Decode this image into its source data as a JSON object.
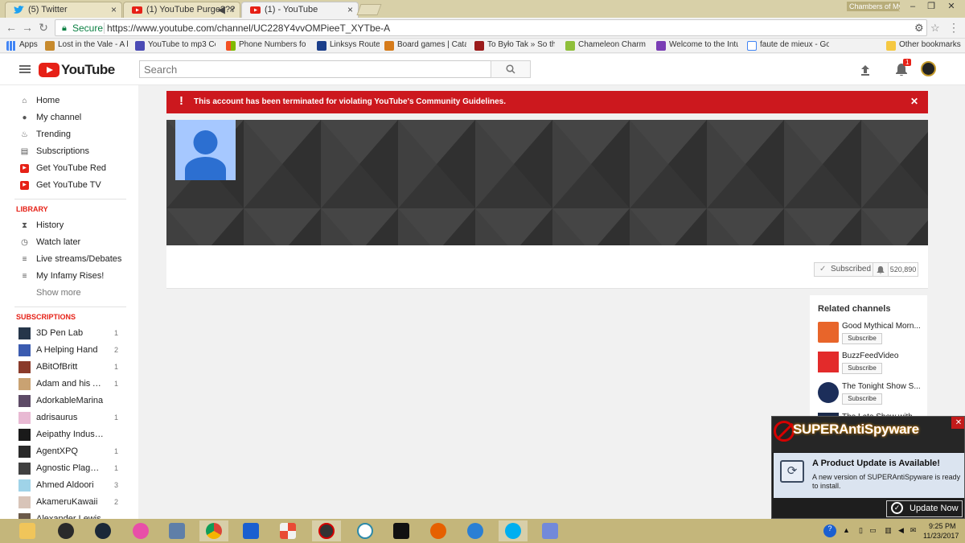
{
  "browser": {
    "tabs": [
      {
        "title": "(5) Twitter",
        "color": "#1da1f2"
      },
      {
        "title": "(1) YouTube Purge???",
        "color": "#e62117"
      },
      {
        "title": "(1) - YouTube",
        "color": "#e62117"
      }
    ],
    "profile_name": "Chambers of My",
    "secure_label": "Secure",
    "url": "https://www.youtube.com/channel/UC228Y4vvOMPieeT_XYTbe-A",
    "bookmarks": [
      "Apps",
      "Lost in the Vale - A lo",
      "YouTube to mp3 Con",
      "Phone Numbers for I",
      "Linksys Router",
      "Board games | Catan",
      "To Było Tak » So the",
      "Chameleon Charm - (",
      "Welcome to the Intuc",
      "faute de mieux - Goo",
      "Other bookmarks"
    ]
  },
  "youtube": {
    "logo_text": "YouTube",
    "search_placeholder": "Search",
    "notification_count": "1"
  },
  "sidebar": {
    "main_items": [
      "Home",
      "My channel",
      "Trending",
      "Subscriptions",
      "Get YouTube Red",
      "Get YouTube TV"
    ],
    "library_heading": "LIBRARY",
    "library_items": [
      "History",
      "Watch later",
      "Live streams/Debates",
      "My Infamy Rises!"
    ],
    "show_more": "Show more",
    "subscriptions_heading": "SUBSCRIPTIONS",
    "subscriptions": [
      {
        "name": "3D Pen Lab",
        "count": "1"
      },
      {
        "name": "A Helping Hand",
        "count": "2"
      },
      {
        "name": "ABitOfBritt",
        "count": "1"
      },
      {
        "name": "Adam and his Ap...",
        "count": "1"
      },
      {
        "name": "AdorkableMarina",
        "count": ""
      },
      {
        "name": "adrisaurus",
        "count": "1"
      },
      {
        "name": "Aeipathy Industries",
        "count": ""
      },
      {
        "name": "AgentXPQ",
        "count": "1"
      },
      {
        "name": "Agnostic Plague ...",
        "count": "1"
      },
      {
        "name": "Ahmed Aldoori",
        "count": "3"
      },
      {
        "name": "AkameruKawaii",
        "count": "2"
      },
      {
        "name": "Alexander Lewis",
        "count": ""
      }
    ]
  },
  "channel": {
    "alert_text": "This account has been terminated for violating YouTube's Community Guidelines.",
    "subscribed_label": "Subscribed",
    "subscriber_count": "520,890"
  },
  "related": {
    "title": "Related channels",
    "subscribe_label": "Subscribe",
    "channels": [
      {
        "name": "Good Mythical Morn..."
      },
      {
        "name": "BuzzFeedVideo"
      },
      {
        "name": "The Tonight Show S..."
      },
      {
        "name": "The Late Show with"
      }
    ]
  },
  "popup": {
    "title": "SUPERAntiSpyware",
    "heading": "A Product Update is Available!",
    "message": "A new version of SUPERAntiSpyware is ready to install.",
    "button": "Update Now"
  },
  "taskbar": {
    "time": "9:25 PM",
    "date": "11/23/2017"
  }
}
